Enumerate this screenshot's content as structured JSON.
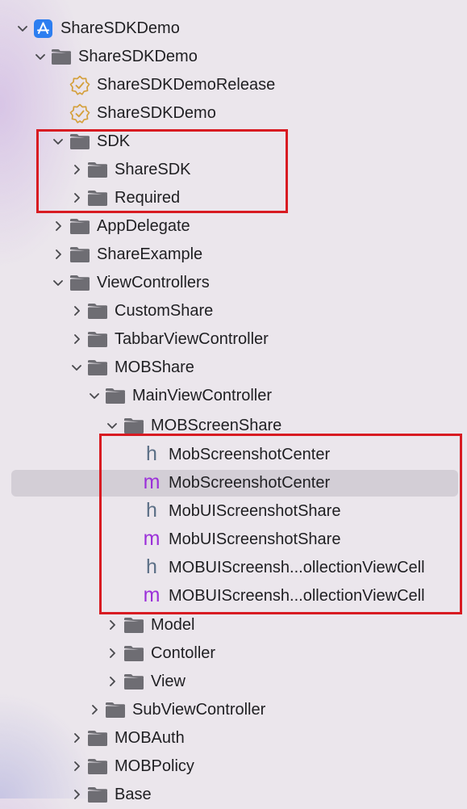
{
  "tree": {
    "items": [
      {
        "label": "ShareSDKDemo",
        "icon": "app-project-icon",
        "expanded": true
      },
      {
        "label": "ShareSDKDemo",
        "icon": "folder-icon",
        "expanded": true
      },
      {
        "label": "ShareSDKDemoRelease",
        "icon": "entitlements-badge-icon"
      },
      {
        "label": "ShareSDKDemo",
        "icon": "entitlements-badge-icon"
      },
      {
        "label": "SDK",
        "icon": "folder-icon",
        "expanded": true
      },
      {
        "label": "ShareSDK",
        "icon": "folder-icon",
        "expanded": false
      },
      {
        "label": "Required",
        "icon": "folder-icon",
        "expanded": false
      },
      {
        "label": "AppDelegate",
        "icon": "folder-icon",
        "expanded": false
      },
      {
        "label": "ShareExample",
        "icon": "folder-icon",
        "expanded": false
      },
      {
        "label": "ViewControllers",
        "icon": "folder-icon",
        "expanded": true
      },
      {
        "label": "CustomShare",
        "icon": "folder-icon",
        "expanded": false
      },
      {
        "label": "TabbarViewController",
        "icon": "folder-icon",
        "expanded": false
      },
      {
        "label": "MOBShare",
        "icon": "folder-icon",
        "expanded": true
      },
      {
        "label": "MainViewController",
        "icon": "folder-icon",
        "expanded": true
      },
      {
        "label": "MOBScreenShare",
        "icon": "folder-icon",
        "expanded": true
      },
      {
        "label": "MobScreenshotCenter",
        "icon": "header-file-icon",
        "letter": "h"
      },
      {
        "label": "MobScreenshotCenter",
        "icon": "implementation-file-icon",
        "letter": "m",
        "selected": true
      },
      {
        "label": "MobUIScreenshotShare",
        "icon": "header-file-icon",
        "letter": "h"
      },
      {
        "label": "MobUIScreenshotShare",
        "icon": "implementation-file-icon",
        "letter": "m"
      },
      {
        "label": "MOBUIScreensh...ollectionViewCell",
        "icon": "header-file-icon",
        "letter": "h"
      },
      {
        "label": "MOBUIScreensh...ollectionViewCell",
        "icon": "implementation-file-icon",
        "letter": "m"
      },
      {
        "label": "Model",
        "icon": "folder-icon",
        "expanded": false
      },
      {
        "label": "Contoller",
        "icon": "folder-icon",
        "expanded": false
      },
      {
        "label": "View",
        "icon": "folder-icon",
        "expanded": false
      },
      {
        "label": "SubViewController",
        "icon": "folder-icon",
        "expanded": false
      },
      {
        "label": "MOBAuth",
        "icon": "folder-icon",
        "expanded": false
      },
      {
        "label": "MOBPolicy",
        "icon": "folder-icon",
        "expanded": false
      },
      {
        "label": "Base",
        "icon": "folder-icon",
        "expanded": false
      }
    ]
  },
  "colors": {
    "background": "#ebe6ec",
    "highlight_border": "#d81b22",
    "selection": "#d3ced6",
    "folder": "#6e6d73",
    "chevron": "#4a4a4e",
    "app_icon": "#2d7ef0",
    "badge": "#d4a03c",
    "header_letter": "#5b6f86",
    "impl_letter": "#9b30d9"
  }
}
